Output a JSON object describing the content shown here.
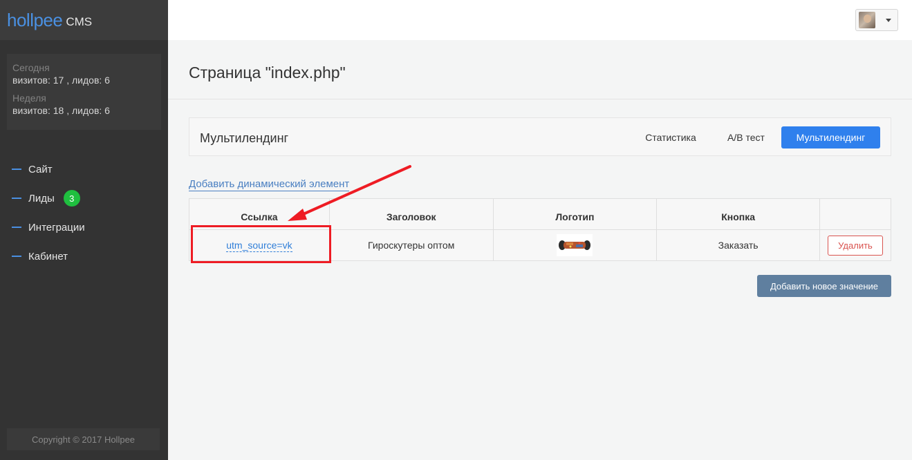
{
  "sidebar": {
    "logo_main": "hollpee",
    "logo_cms": "CMS",
    "stats": {
      "today_label": "Сегодня",
      "today_value": "визитов: 17 , лидов: 6",
      "week_label": "Неделя",
      "week_value": "визитов: 18 , лидов: 6"
    },
    "nav": [
      {
        "label": "Сайт"
      },
      {
        "label": "Лиды",
        "badge": "3"
      },
      {
        "label": "Интеграции"
      },
      {
        "label": "Кабинет"
      }
    ],
    "copyright": "Copyright © 2017 Hollpee"
  },
  "header": {
    "page_title": "Страница \"index.php\""
  },
  "panel": {
    "title": "Мультилендинг",
    "tabs": {
      "stats": "Статистика",
      "ab": "A/B тест",
      "multi": "Мультилендинг"
    },
    "active_tab": "Мультилендинг"
  },
  "add_dynamic_link": "Добавить динамический элемент",
  "table": {
    "headers": [
      "Ссылка",
      "Заголовок",
      "Логотип",
      "Кнопка",
      ""
    ],
    "rows": [
      {
        "link": "utm_source=vk",
        "title": "Гироскутеры оптом",
        "logo_icon": "hoverboard-image",
        "button": "Заказать",
        "delete_label": "Удалить"
      }
    ]
  },
  "add_value_button": "Добавить новое значение",
  "colors": {
    "accent": "#2f80ed",
    "annotation": "#ee1c24",
    "badge": "#1fbf3f",
    "sidebar_bg": "#333333"
  }
}
